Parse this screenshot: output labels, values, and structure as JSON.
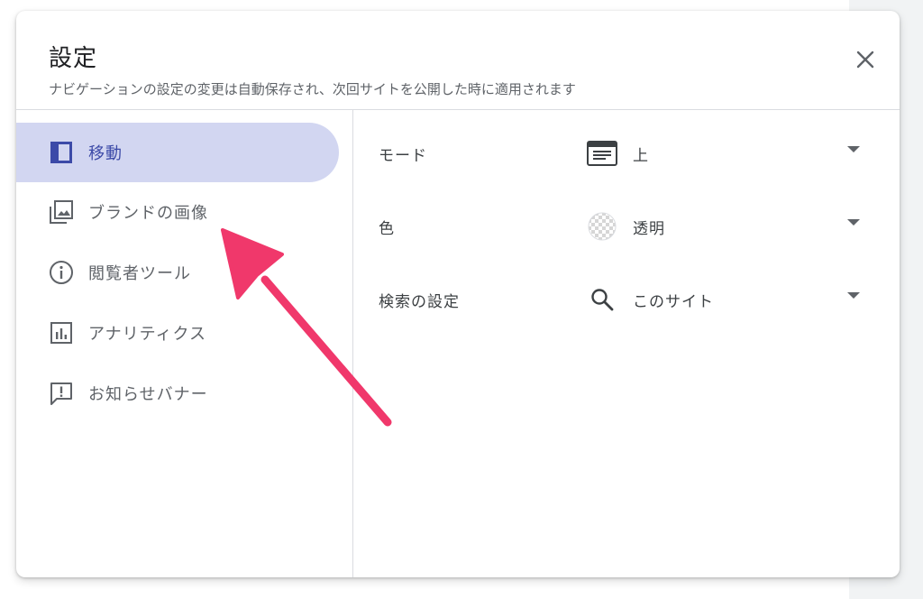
{
  "dialog": {
    "title": "設定",
    "subtitle": "ナビゲーションの設定の変更は自動保存され、次回サイトを公開した時に適用されます",
    "close_icon": "close-icon"
  },
  "nav": {
    "items": [
      {
        "label": "移動",
        "icon": "layout-icon",
        "active": true
      },
      {
        "label": "ブランドの画像",
        "icon": "image-icon",
        "active": false
      },
      {
        "label": "閲覧者ツール",
        "icon": "info-icon",
        "active": false
      },
      {
        "label": "アナリティクス",
        "icon": "analytics-icon",
        "active": false
      },
      {
        "label": "お知らせバナー",
        "icon": "announcement-icon",
        "active": false
      }
    ]
  },
  "settings": {
    "rows": [
      {
        "label": "モード",
        "value": "上",
        "icon": "top-nav-icon"
      },
      {
        "label": "色",
        "value": "透明",
        "icon": "transparent-icon"
      },
      {
        "label": "検索の設定",
        "value": "このサイト",
        "icon": "search-icon"
      }
    ]
  },
  "colors": {
    "active_bg": "#d2d6f1",
    "active_text": "#3c4aa8",
    "annotation_arrow": "#f0386b"
  }
}
